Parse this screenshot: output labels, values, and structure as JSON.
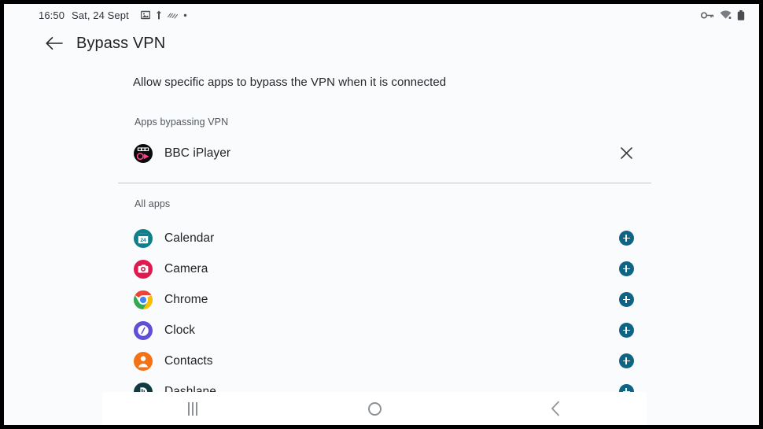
{
  "status_bar": {
    "time": "16:50",
    "date": "Sat, 24 Sept",
    "left_icons": [
      "image-icon",
      "notification-arrow-icon",
      "squiggle-icon",
      "dot-icon"
    ],
    "right_icons": [
      "vpn-key-icon",
      "wifi-icon",
      "battery-icon"
    ]
  },
  "app_bar": {
    "back_icon": "arrow-left-icon",
    "title": "Bypass VPN"
  },
  "page": {
    "description": "Allow specific apps to bypass the VPN when it is connected",
    "bypassing_section_label": "Apps bypassing VPN",
    "all_apps_section_label": "All apps"
  },
  "bypassing_apps": [
    {
      "name": "BBC iPlayer",
      "icon": "bbc-iplayer-icon",
      "action_icon": "close-icon"
    }
  ],
  "all_apps": [
    {
      "name": "Calendar",
      "icon": "calendar-icon",
      "action_icon": "add-icon"
    },
    {
      "name": "Camera",
      "icon": "camera-icon",
      "action_icon": "add-icon"
    },
    {
      "name": "Chrome",
      "icon": "chrome-icon",
      "action_icon": "add-icon"
    },
    {
      "name": "Clock",
      "icon": "clock-icon",
      "action_icon": "add-icon"
    },
    {
      "name": "Contacts",
      "icon": "contacts-icon",
      "action_icon": "add-icon"
    },
    {
      "name": "Dashlane",
      "icon": "dashlane-icon",
      "action_icon": "add-icon"
    }
  ],
  "nav_bar": {
    "recents_label": "Recents",
    "home_label": "Home",
    "back_label": "Back"
  },
  "colors": {
    "accent_add_button": "#0d6485",
    "background": "#fafbfc",
    "nav_bar_background": "#ffffff",
    "divider": "#c3c6ca",
    "primary_text": "#1f2226",
    "secondary_text": "#52575c"
  }
}
